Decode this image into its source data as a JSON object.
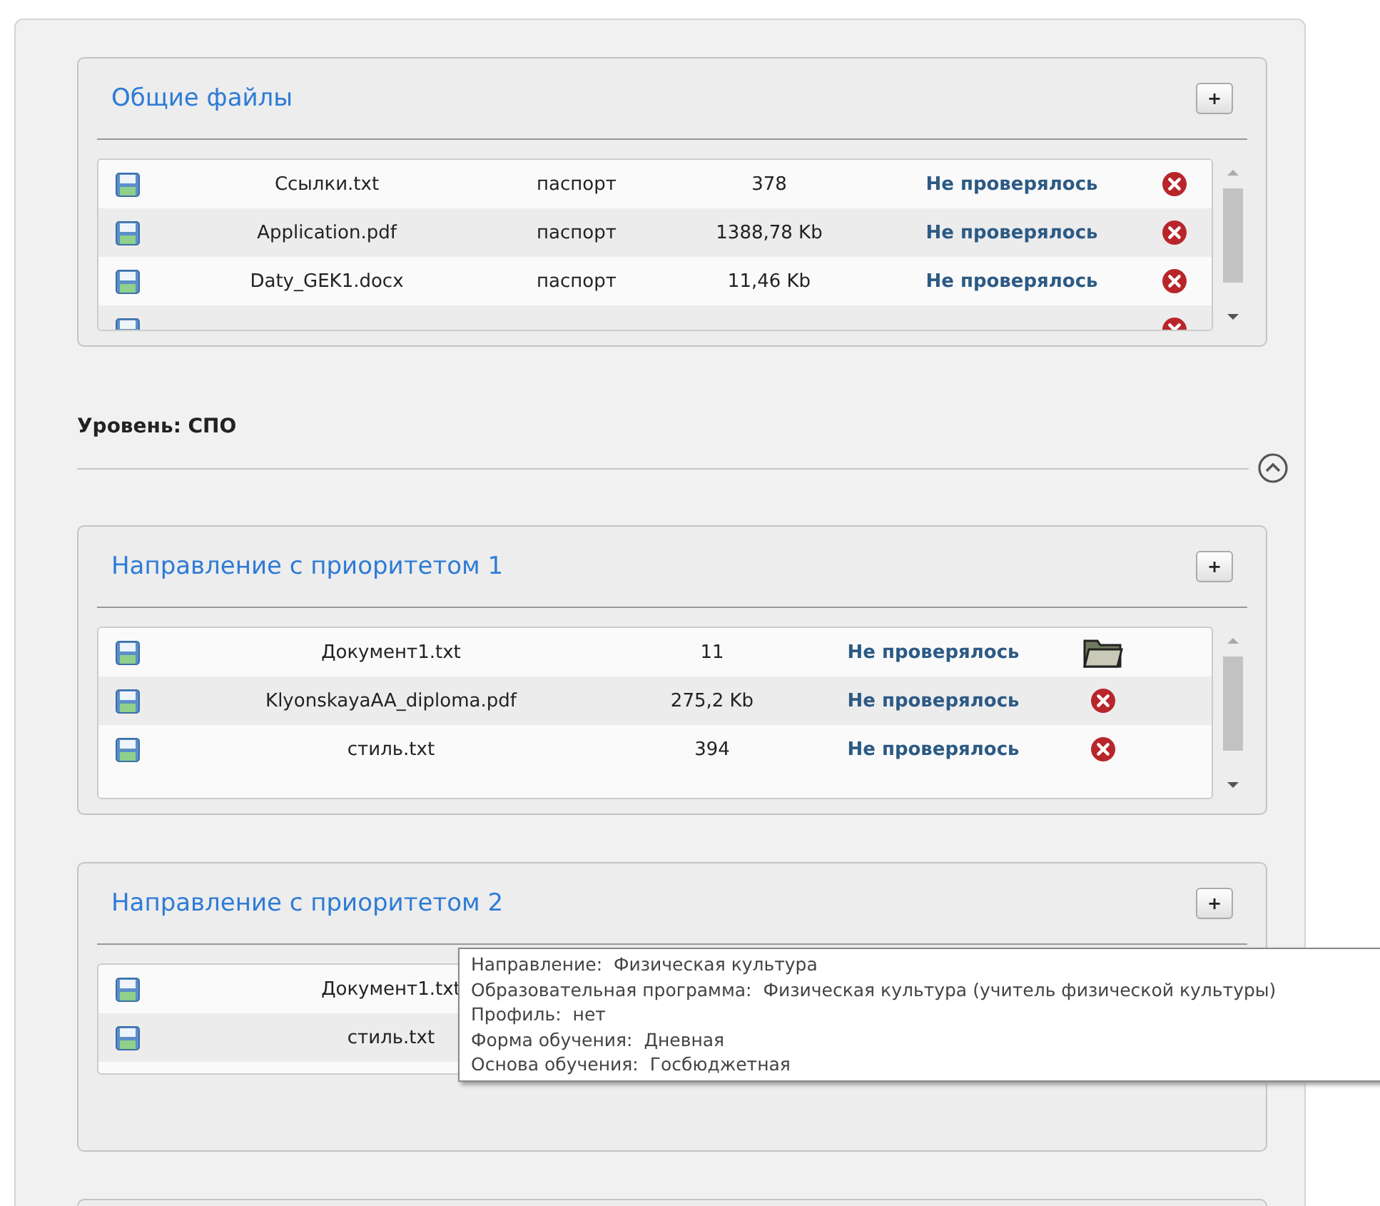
{
  "blocks": [
    {
      "kind": "panel",
      "title": "Общие файлы",
      "add_label": "+",
      "scrollbar": true,
      "rows": [
        {
          "name": "Ссылки.txt",
          "doc_type": "паспорт",
          "size": "378",
          "status": "Не проверялось",
          "kind": "delete"
        },
        {
          "name": "Application.pdf",
          "doc_type": "паспорт",
          "size": "1388,78 Kb",
          "status": "Не проверялось",
          "kind": "delete"
        },
        {
          "name": "Daty_GEK1.docx",
          "doc_type": "паспорт",
          "size": "11,46 Kb",
          "status": "Не проверялось",
          "kind": "delete"
        },
        {
          "kind": "delete"
        }
      ]
    },
    {
      "kind": "level",
      "label": "Уровень: СПО"
    },
    {
      "kind": "panel",
      "title": "Направление с приоритетом 1",
      "add_label": "+",
      "scrollbar": true,
      "rows": [
        {
          "name": "Документ1.txt",
          "size": "11",
          "status": "Не проверялось",
          "kind": "folder"
        },
        {
          "name": "KlyonskayaAA_diploma.pdf",
          "size": "275,2 Kb",
          "status": "Не проверялось",
          "kind": "delete"
        },
        {
          "name": "стиль.txt",
          "size": "394",
          "status": "Не проверялось",
          "kind": "delete"
        }
      ]
    },
    {
      "kind": "panel",
      "title": "Направление с приоритетом 2",
      "add_label": "+",
      "rows": [
        {
          "name": "Документ1.txt"
        },
        {
          "name": "стиль.txt"
        }
      ],
      "tooltip": [
        "Направление:  Физическая культура",
        "Образовательная программа:  Физическая культура (учитель физической культуры)",
        "Профиль:  нет",
        "Форма обучения:  Дневная",
        "Основа обучения:  Госбюджетная"
      ]
    },
    {
      "kind": "panel"
    }
  ]
}
